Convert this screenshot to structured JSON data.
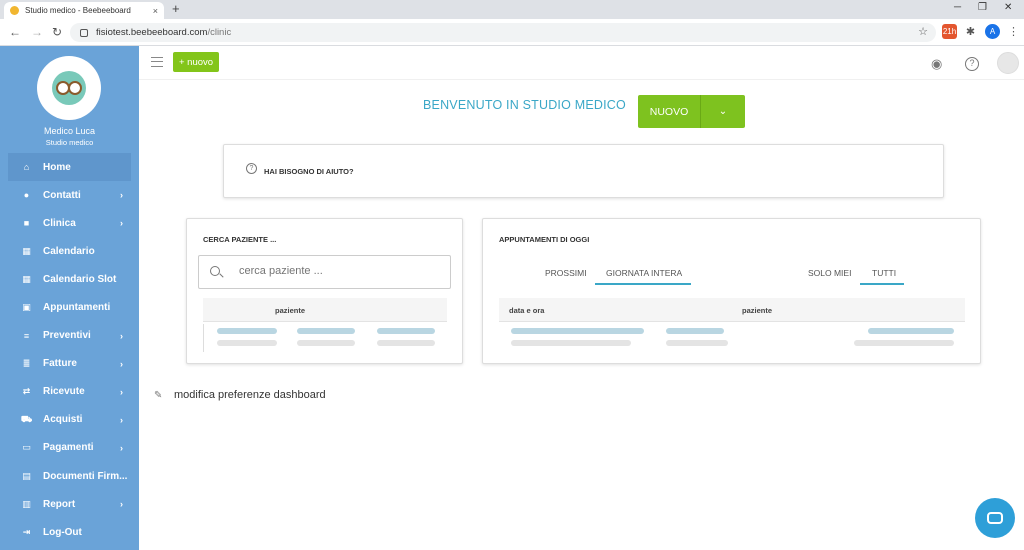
{
  "browser": {
    "tab_title": "Studio medico - Beebeeboard",
    "tab_close": "×",
    "new_tab": "+",
    "url_host": "fisiotest.beebeeboard.com",
    "url_path": "/clinic",
    "profile_initial": "A",
    "ext_badge": "21h"
  },
  "user": {
    "name": "Medico Luca",
    "clinic": "Studio medico"
  },
  "sidebar": {
    "items": [
      {
        "label": "Home",
        "icon": "home-icon",
        "arrow": ""
      },
      {
        "label": "Contatti",
        "icon": "person-icon",
        "arrow": "›"
      },
      {
        "label": "Clinica",
        "icon": "medical-bag-icon",
        "arrow": "›"
      },
      {
        "label": "Calendario",
        "icon": "calendar-icon",
        "arrow": ""
      },
      {
        "label": "Calendario Slot",
        "icon": "calendar-icon",
        "arrow": ""
      },
      {
        "label": "Appuntamenti",
        "icon": "event-icon",
        "arrow": ""
      },
      {
        "label": "Preventivi",
        "icon": "quote-icon",
        "arrow": "›"
      },
      {
        "label": "Fatture",
        "icon": "invoice-icon",
        "arrow": "›"
      },
      {
        "label": "Ricevute",
        "icon": "receipt-icon",
        "arrow": "›"
      },
      {
        "label": "Acquisti",
        "icon": "cart-icon",
        "arrow": "›"
      },
      {
        "label": "Pagamenti",
        "icon": "credit-card-icon",
        "arrow": "›"
      },
      {
        "label": "Documenti Firm...",
        "icon": "document-icon",
        "arrow": ""
      },
      {
        "label": "Report",
        "icon": "report-icon",
        "arrow": "›"
      },
      {
        "label": "Log-Out",
        "icon": "logout-icon",
        "arrow": ""
      }
    ]
  },
  "topbar": {
    "new_label": "+ nuovo"
  },
  "main": {
    "welcome": "BENVENUTO IN STUDIO MEDICO",
    "new_button": "NUOVO",
    "help_text": "HAI BISOGNO DI AIUTO?",
    "search_card": {
      "title": "CERCA PAZIENTE ...",
      "placeholder": "cerca paziente ...",
      "column": "paziente"
    },
    "appointments_card": {
      "title": "APPUNTAMENTI DI OGGI",
      "tab_next": "PROSSIMI",
      "tab_full_day": "GIORNATA INTERA",
      "tab_mine": "SOLO MIEI",
      "tab_all": "TUTTI",
      "col_date": "data e ora",
      "col_patient": "paziente"
    },
    "dashboard_pref": "modifica preferenze dashboard"
  },
  "colors": {
    "sidebar": "#6aa3d8",
    "accent_green": "#83c51a",
    "accent_teal": "#3aa7c7"
  }
}
